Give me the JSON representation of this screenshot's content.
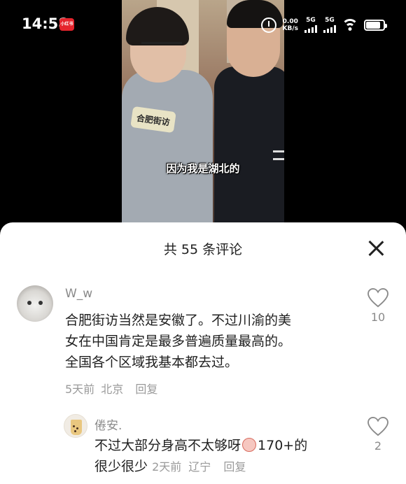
{
  "status_bar": {
    "time": "14:58",
    "app_badge": "小红书",
    "net_speed_value": "0.00",
    "net_speed_unit": "KB/s",
    "signal1_label": "5G",
    "signal2_label": "5G",
    "battery_level": 0.85
  },
  "video": {
    "mic_tag": "合肥街访",
    "subtitle": "因为我是湖北的"
  },
  "comments_panel": {
    "title": "共 55 条评论",
    "comments": [
      {
        "username": "W_w",
        "text_lines": [
          "合肥街访当然是安徽了。不过川渝的美",
          "女在中国肯定是最多普遍质量最高的。",
          "全国各个区域我基本都去过。"
        ],
        "time": "5天前",
        "location": "北京",
        "reply_label": "回复",
        "likes": "10"
      },
      {
        "username": "倦安.",
        "text_line1_before": "不过大部分身高不太够呀",
        "text_line1_after": "170+的",
        "text_line2": "很少很少",
        "time": "2天前",
        "location": "辽宁",
        "reply_label": "回复",
        "likes": "2"
      }
    ]
  },
  "icons": {
    "close": "close-icon",
    "like": "heart-icon",
    "alarm": "alarm-icon",
    "wifi": "wifi-icon",
    "battery": "battery-icon"
  },
  "colors": {
    "badge_red": "#e5242c",
    "sheet_bg": "#ffffff",
    "text_primary": "#1f1f1f",
    "text_secondary": "#9a9a9a"
  }
}
